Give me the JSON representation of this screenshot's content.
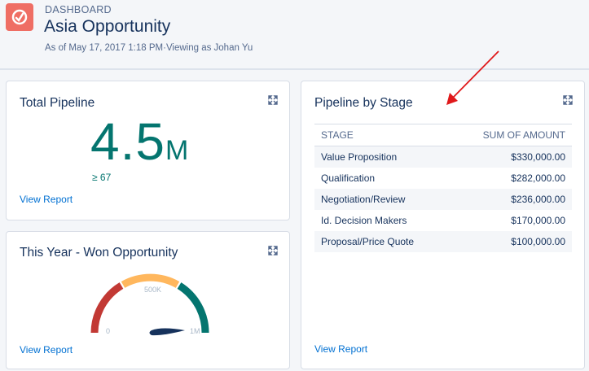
{
  "header": {
    "eyebrow": "DASHBOARD",
    "title": "Asia Opportunity",
    "meta": "As of May 17, 2017 1:18 PM·Viewing as Johan Yu",
    "icon": "dashboard-gauge-icon",
    "icon_color": "#ef6e64"
  },
  "total_pipeline": {
    "title": "Total Pipeline",
    "value": "4.5",
    "unit": "M",
    "subvalue": "≥ 67",
    "link": "View Report",
    "value_color": "#04756f"
  },
  "won_opportunity": {
    "title": "This Year - Won Opportunity",
    "gauge_min": "0",
    "gauge_mid": "500K",
    "gauge_max": "1M",
    "link": "View Report",
    "segment_colors": [
      "#c23934",
      "#ffb75d",
      "#04756f"
    ]
  },
  "pipeline_by_stage": {
    "title": "Pipeline by Stage",
    "columns": [
      "STAGE",
      "SUM OF AMOUNT"
    ],
    "rows": [
      {
        "stage": "Value Proposition",
        "amount": "$330,000.00"
      },
      {
        "stage": "Qualification",
        "amount": "$282,000.00"
      },
      {
        "stage": "Negotiation/Review",
        "amount": "$236,000.00"
      },
      {
        "stage": "Id. Decision Makers",
        "amount": "$170,000.00"
      },
      {
        "stage": "Proposal/Price Quote",
        "amount": "$100,000.00"
      }
    ],
    "link": "View Report"
  },
  "annotation": {
    "arrow_color": "#e0191b"
  }
}
